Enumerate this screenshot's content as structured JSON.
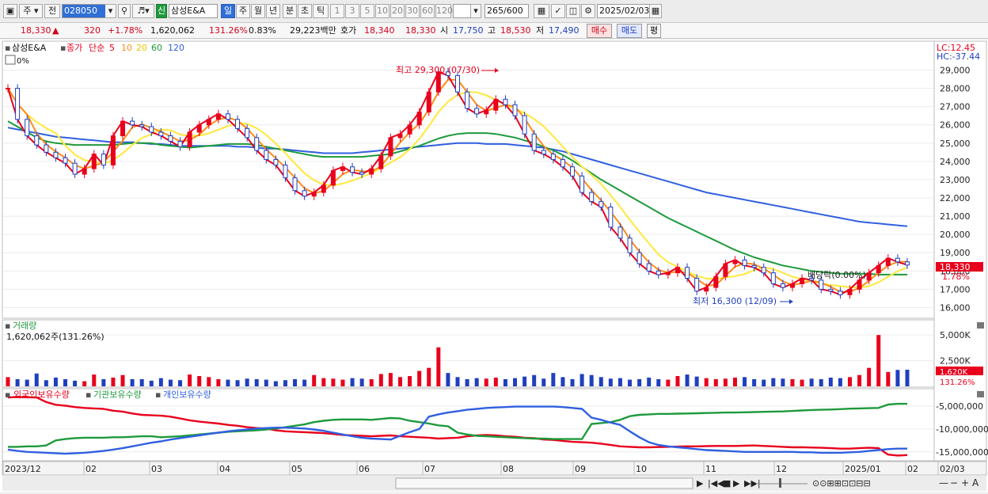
{
  "toolbar": {
    "period_short": "주",
    "prev_label": "전",
    "stock_code": "028050",
    "category_badge": "신",
    "stock_name": "삼성E&A",
    "periods": [
      "일",
      "주",
      "월",
      "년",
      "분",
      "초",
      "틱"
    ],
    "selected_period": "일",
    "numbers": [
      "1",
      "3",
      "5",
      "10",
      "20",
      "30",
      "60",
      "120"
    ],
    "count": "265",
    "count_total": "/600",
    "date": "2025/02/03"
  },
  "quote": {
    "price": "18,330",
    "arrow": "▲",
    "change": "320",
    "change_pct": "+1.78%",
    "volume": "1,620,062",
    "vol_ratio": "131.26%",
    "turnover": "0.83%",
    "amount": "29,223백만",
    "bid_label": "호가",
    "ask": "18,340",
    "bid": "18,330",
    "open_label": "시",
    "open": "17,750",
    "high_label": "고",
    "high": "18,530",
    "low_label": "저",
    "low": "17,490",
    "buy_label": "매수",
    "sell_label": "매도",
    "eval_label": "평"
  },
  "colors": {
    "up": "#e8001c",
    "down": "#1f3fbf",
    "ma5": "#e8001c",
    "ma10": "#ff8c1a",
    "ma20": "#ffe94a",
    "ma60": "#1e9a3c",
    "ma120": "#3060e0",
    "foreign": "#e8001c",
    "institution": "#1e9a3c",
    "individual": "#3060e0"
  },
  "chart_data": [
    {
      "type": "candlestick",
      "title": "삼성E&A",
      "legend": {
        "price_type": "종가",
        "ma_type": "단순",
        "periods": [
          "5",
          "10",
          "20",
          "60",
          "120"
        ]
      },
      "scale_label": "0%",
      "lc_label": "LC:12.45",
      "hc_label": "HC:-37.44",
      "x_ticks": [
        "2023/12",
        "02",
        "03",
        "04",
        "05",
        "06",
        "07",
        "08",
        "09",
        "10",
        "11",
        "12",
        "2025/01",
        "02",
        "02/03"
      ],
      "ylim": [
        15500,
        29800
      ],
      "yticks": [
        "29,000",
        "28,000",
        "27,000",
        "26,000",
        "25,000",
        "24,000",
        "23,000",
        "22,000",
        "21,000",
        "20,000",
        "19,000",
        "18,000",
        "17,000",
        "16,000"
      ],
      "current_price_label": "18,330",
      "current_change_label": "1.78%",
      "high_annotation": "최고 29,300 (07/30)",
      "low_annotation": "최저 16,300 (12/09)",
      "dividend_annotation": "배당락(0.00%)",
      "close": [
        28000,
        26300,
        25400,
        24900,
        24500,
        24200,
        23900,
        23300,
        23600,
        24400,
        23800,
        25400,
        26200,
        26000,
        25900,
        25600,
        25400,
        25100,
        24800,
        25600,
        26000,
        26300,
        26600,
        26300,
        25800,
        25300,
        24600,
        24100,
        23800,
        23100,
        22400,
        22100,
        22300,
        22700,
        23500,
        23700,
        23400,
        23300,
        23600,
        24300,
        25300,
        25500,
        26000,
        26700,
        27800,
        28900,
        28700,
        27800,
        26900,
        26600,
        26800,
        27400,
        27100,
        26500,
        25500,
        24600,
        24400,
        24100,
        23700,
        23200,
        22300,
        21800,
        21500,
        20400,
        19800,
        19000,
        18400,
        18000,
        17800,
        17900,
        18200,
        17600,
        16900,
        17100,
        17700,
        18400,
        18600,
        18300,
        18200,
        17900,
        17300,
        17100,
        17300,
        17600,
        17500,
        17000,
        16900,
        16700,
        17000,
        17500,
        17900,
        18300,
        18700,
        18500,
        18330
      ],
      "ma120": [
        25850,
        25750,
        25650,
        25550,
        25450,
        25350,
        25300,
        25250,
        25200,
        25150,
        25100,
        25050,
        25050,
        25050,
        25000,
        24950,
        24950,
        24900,
        24850,
        24850,
        24850,
        24850,
        24850,
        24850,
        24800,
        24800,
        24750,
        24700,
        24700,
        24650,
        24600,
        24550,
        24500,
        24450,
        24450,
        24450,
        24450,
        24500,
        24550,
        24600,
        24650,
        24700,
        24750,
        24800,
        24850,
        24900,
        24950,
        25000,
        25000,
        25000,
        24950,
        24950,
        24950,
        24900,
        24850,
        24800,
        24750,
        24650,
        24550,
        24400,
        24250,
        24100,
        23950,
        23800,
        23650,
        23500,
        23350,
        23200,
        23050,
        22900,
        22750,
        22600,
        22450,
        22300,
        22200,
        22100,
        22000,
        21900,
        21800,
        21700,
        21600,
        21500,
        21400,
        21300,
        21200,
        21100,
        21000,
        20900,
        20800,
        20700,
        20650,
        20600,
        20550,
        20500,
        20450
      ],
      "ma60": [
        26200,
        25900,
        25600,
        25300,
        25100,
        25000,
        24950,
        24900,
        24900,
        24900,
        24900,
        24900,
        24950,
        25000,
        25000,
        25000,
        24900,
        24850,
        24800,
        24750,
        24800,
        24850,
        24900,
        24950,
        24950,
        24950,
        24900,
        24800,
        24700,
        24600,
        24500,
        24400,
        24300,
        24250,
        24250,
        24250,
        24250,
        24250,
        24300,
        24350,
        24400,
        24550,
        24700,
        24850,
        25050,
        25250,
        25400,
        25500,
        25550,
        25550,
        25550,
        25500,
        25400,
        25300,
        25150,
        25000,
        24800,
        24600,
        24350,
        24050,
        23700,
        23350,
        23000,
        22700,
        22400,
        22100,
        21800,
        21500,
        21200,
        20900,
        20650,
        20400,
        20150,
        19900,
        19650,
        19400,
        19150,
        18950,
        18750,
        18600,
        18450,
        18300,
        18200,
        18100,
        18000,
        17950,
        17900,
        17850,
        17850,
        17850,
        17850,
        17800,
        17800,
        17800,
        17800
      ]
    },
    {
      "type": "bar",
      "title": "거래량",
      "volume_label": "1,620,062주(131.26%)",
      "ylim": [
        0,
        5400000
      ],
      "yticks": [
        "5,000K",
        "2,500K"
      ],
      "current_volume_label": "1,620K",
      "current_ratio_label": "131.26%",
      "values": [
        900,
        700,
        650,
        1250,
        600,
        850,
        700,
        550,
        500,
        1150,
        700,
        850,
        1100,
        700,
        700,
        550,
        800,
        650,
        600,
        1150,
        1000,
        900,
        700,
        650,
        600,
        750,
        700,
        650,
        500,
        600,
        700,
        650,
        1100,
        800,
        750,
        650,
        800,
        750,
        700,
        1200,
        1300,
        900,
        1000,
        1500,
        1800,
        3800,
        1300,
        900,
        700,
        800,
        750,
        850,
        700,
        800,
        950,
        1100,
        750,
        1300,
        900,
        700,
        1200,
        1100,
        900,
        750,
        800,
        650,
        700,
        850,
        700,
        650,
        1000,
        1150,
        950,
        800,
        700,
        750,
        850,
        900,
        700,
        650,
        800,
        750,
        700,
        650,
        750,
        700,
        850,
        800,
        900,
        1100,
        1800,
        5000,
        1400,
        1600,
        1620
      ]
    },
    {
      "type": "line",
      "series": [
        {
          "name": "외국인보유수량",
          "values": [
            -3100,
            -3000,
            -3050,
            -3100,
            -4100,
            -4700,
            -4900,
            -5200,
            -5400,
            -5500,
            -5600,
            -6000,
            -6200,
            -6600,
            -6900,
            -7000,
            -7100,
            -7300,
            -7700,
            -8100,
            -8400,
            -8600,
            -8800,
            -9100,
            -9300,
            -9600,
            -9800,
            -9900,
            -10300,
            -10500,
            -10600,
            -10700,
            -10800,
            -10900,
            -11100,
            -11300,
            -11400,
            -11500,
            -11600,
            -11500,
            -11400,
            -11600,
            -11700,
            -11800,
            -11900,
            -12100,
            -12000,
            -11900,
            -11600,
            -11400,
            -11300,
            -11400,
            -11600,
            -11700,
            -11900,
            -12000,
            -12300,
            -12400,
            -12600,
            -12800,
            -12900,
            -13000,
            -13200,
            -13500,
            -13800,
            -13900,
            -14000,
            -14000,
            -13950,
            -13900,
            -13850,
            -13800,
            -13800,
            -13750,
            -13700,
            -13700,
            -13700,
            -13650,
            -13600,
            -13700,
            -13800,
            -13900,
            -14000,
            -14000,
            -14050,
            -14100,
            -14200,
            -14300,
            -14300,
            -14200,
            -14100,
            -14200,
            -15600,
            -15800,
            -15700
          ]
        },
        {
          "name": "기관보유수량",
          "values": [
            -13900,
            -13900,
            -13800,
            -13800,
            -13600,
            -12500,
            -12200,
            -12000,
            -11900,
            -11900,
            -11900,
            -11800,
            -11800,
            -11700,
            -11600,
            -11600,
            -11800,
            -11700,
            -11600,
            -11400,
            -11200,
            -11000,
            -10800,
            -10600,
            -10500,
            -10400,
            -10300,
            -10100,
            -9900,
            -9600,
            -9300,
            -9000,
            -8500,
            -8200,
            -8000,
            -7900,
            -7900,
            -7900,
            -8000,
            -7800,
            -7600,
            -7700,
            -8200,
            -8500,
            -8800,
            -9200,
            -9400,
            -10800,
            -11200,
            -11500,
            -11600,
            -11700,
            -11800,
            -11900,
            -12000,
            -12100,
            -12100,
            -12200,
            -12200,
            -12200,
            -12200,
            -8900,
            -8700,
            -8500,
            -8000,
            -7200,
            -6900,
            -6800,
            -6700,
            -6700,
            -6650,
            -6600,
            -6550,
            -6500,
            -6450,
            -6400,
            -6400,
            -6350,
            -6300,
            -6250,
            -6200,
            -6150,
            -6050,
            -5950,
            -5850,
            -5800,
            -5750,
            -5650,
            -5550,
            -5500,
            -5450,
            -5400,
            -4650,
            -4500,
            -4500
          ]
        },
        {
          "name": "개인보유수량",
          "values": [
            -14500,
            -14800,
            -15000,
            -15100,
            -15200,
            -15300,
            -15400,
            -15300,
            -15200,
            -15000,
            -14800,
            -14500,
            -14200,
            -13800,
            -13400,
            -13000,
            -12700,
            -12300,
            -12000,
            -11700,
            -11400,
            -11100,
            -10800,
            -10500,
            -10300,
            -10100,
            -9900,
            -9800,
            -9700,
            -9700,
            -9800,
            -9900,
            -10100,
            -10400,
            -10800,
            -11200,
            -11600,
            -11900,
            -12100,
            -12200,
            -12300,
            -11500,
            -10700,
            -10000,
            -7300,
            -6800,
            -6400,
            -6100,
            -5800,
            -5600,
            -5400,
            -5300,
            -5200,
            -5100,
            -5100,
            -5100,
            -5100,
            -5100,
            -5200,
            -5400,
            -5600,
            -7500,
            -8000,
            -8600,
            -9100,
            -10500,
            -11800,
            -12900,
            -13500,
            -13800,
            -14000,
            -14200,
            -14400,
            -14600,
            -14700,
            -14800,
            -14900,
            -15000,
            -15000,
            -15000,
            -15000,
            -15000,
            -15000,
            -15100,
            -15100,
            -15200,
            -15200,
            -15200,
            -15100,
            -15000,
            -14800,
            -14600,
            -14400,
            -14300,
            -14300
          ]
        }
      ],
      "ylim": [
        -16600,
        -2400
      ],
      "yticks": [
        "-5,000,000",
        "-10,000,000",
        "-15,000,000"
      ]
    }
  ]
}
